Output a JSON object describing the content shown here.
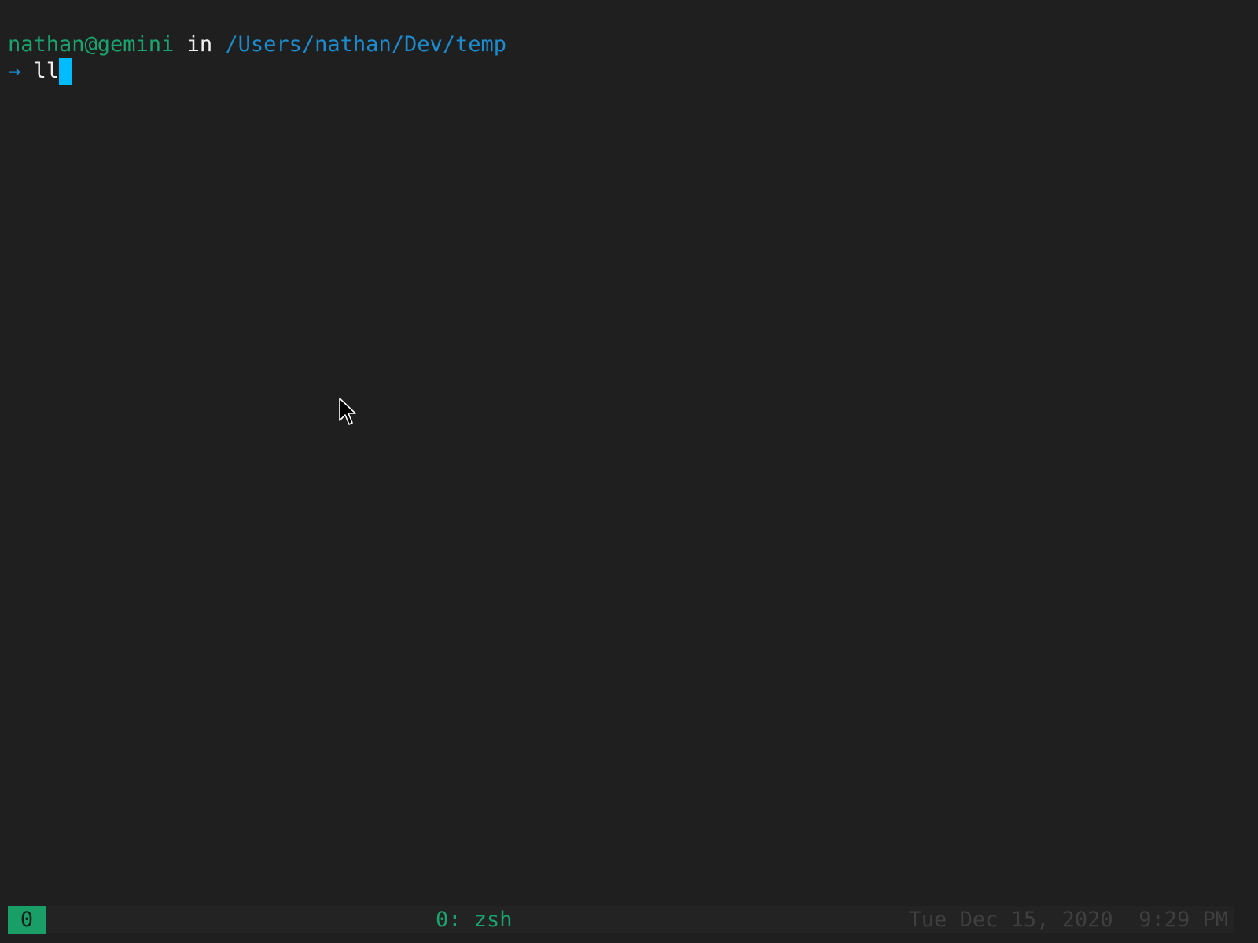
{
  "prompt": {
    "user_host": "nathan@gemini",
    "in_word": "in",
    "path": "/Users/nathan/Dev/temp",
    "arrow": "→",
    "command": "ll"
  },
  "statusbar": {
    "session": "0",
    "window": "0: zsh",
    "date": "Tue Dec 15, 2020",
    "time": "9:29 PM"
  },
  "colors": {
    "background": "#1f1f1f",
    "user_host": "#1aa36f",
    "path": "#1c8ccf",
    "cursor": "#00bcff",
    "session_badge": "#1a9e68",
    "datetime": "#3f3f3f"
  },
  "icons": {
    "pointer": "mouse-pointer-icon"
  }
}
